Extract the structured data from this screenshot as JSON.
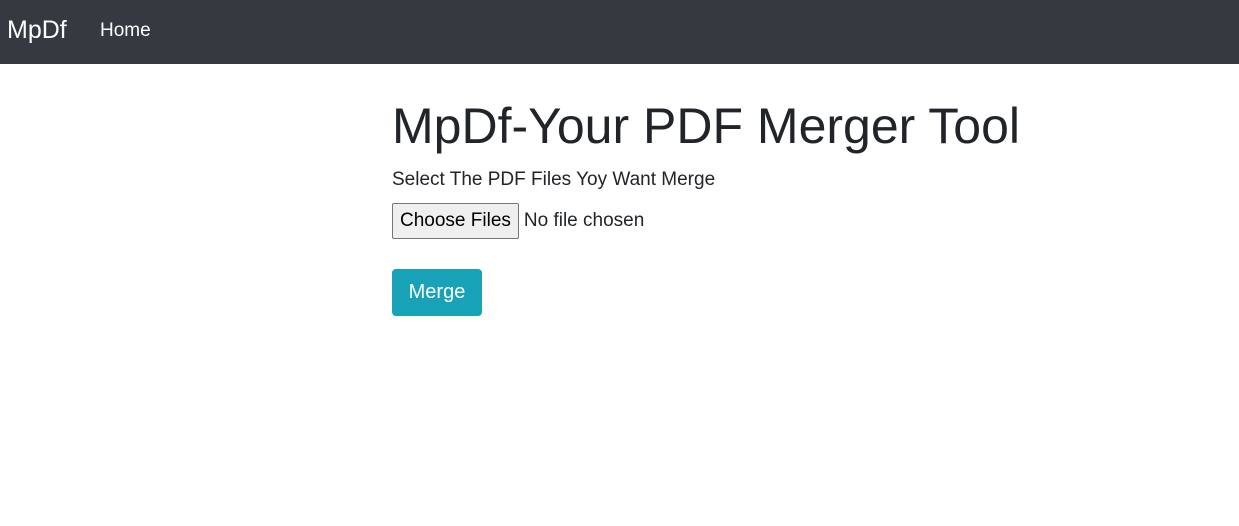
{
  "navbar": {
    "brand": "MpDf",
    "links": [
      {
        "label": "Home"
      }
    ]
  },
  "main": {
    "title": "MpDf-Your PDF Merger Tool",
    "instruction": "Select The PDF Files Yoy Want Merge",
    "file_input": {
      "button_label": "Choose Files",
      "status": "No file chosen"
    },
    "merge_label": "Merge"
  },
  "colors": {
    "navbar_bg": "#343a40",
    "merge_button": "#17a2b8",
    "text": "#212529"
  }
}
